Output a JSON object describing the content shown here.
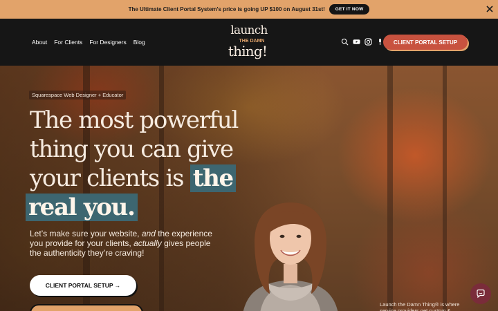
{
  "announcement": {
    "text": "The Ultimate Client Portal System's price is going UP $100 on August 31st!",
    "button_label": "GET IT NOW",
    "close_icon": "close-icon"
  },
  "header": {
    "nav": [
      "About",
      "For Clients",
      "For Designers",
      "Blog"
    ],
    "logo": {
      "line1": "launch",
      "line2": "THE DAMN",
      "line3": "thing!"
    },
    "icons": [
      "search-icon",
      "youtube-icon",
      "instagram-icon",
      "podcast-icon"
    ],
    "cta_label": "CLIENT PORTAL SETUP"
  },
  "hero": {
    "tag": "Squarespace Web Designer + Educator",
    "headline": {
      "line1": "The most powerful",
      "line2": "thing you can give",
      "line3_a": "your clients is ",
      "line3_b": "the",
      "line4": "real you."
    },
    "sub": {
      "a": "Let’s make sure your website, ",
      "b": "and",
      "c": " the experience you provide for your clients, ",
      "d": "actually",
      "e": " gives people the authenticity they’re craving!"
    },
    "cta_label": "CLIENT PORTAL SETUP →",
    "side_text": "Launch the Damn Thing® is where service providers get custom &"
  },
  "colors": {
    "announcement_bg": "#e2a36a",
    "header_bg": "#161616",
    "accent_red": "#c8523f",
    "highlight_teal": "#3d6670",
    "chat_bg": "#7a2c3a"
  }
}
